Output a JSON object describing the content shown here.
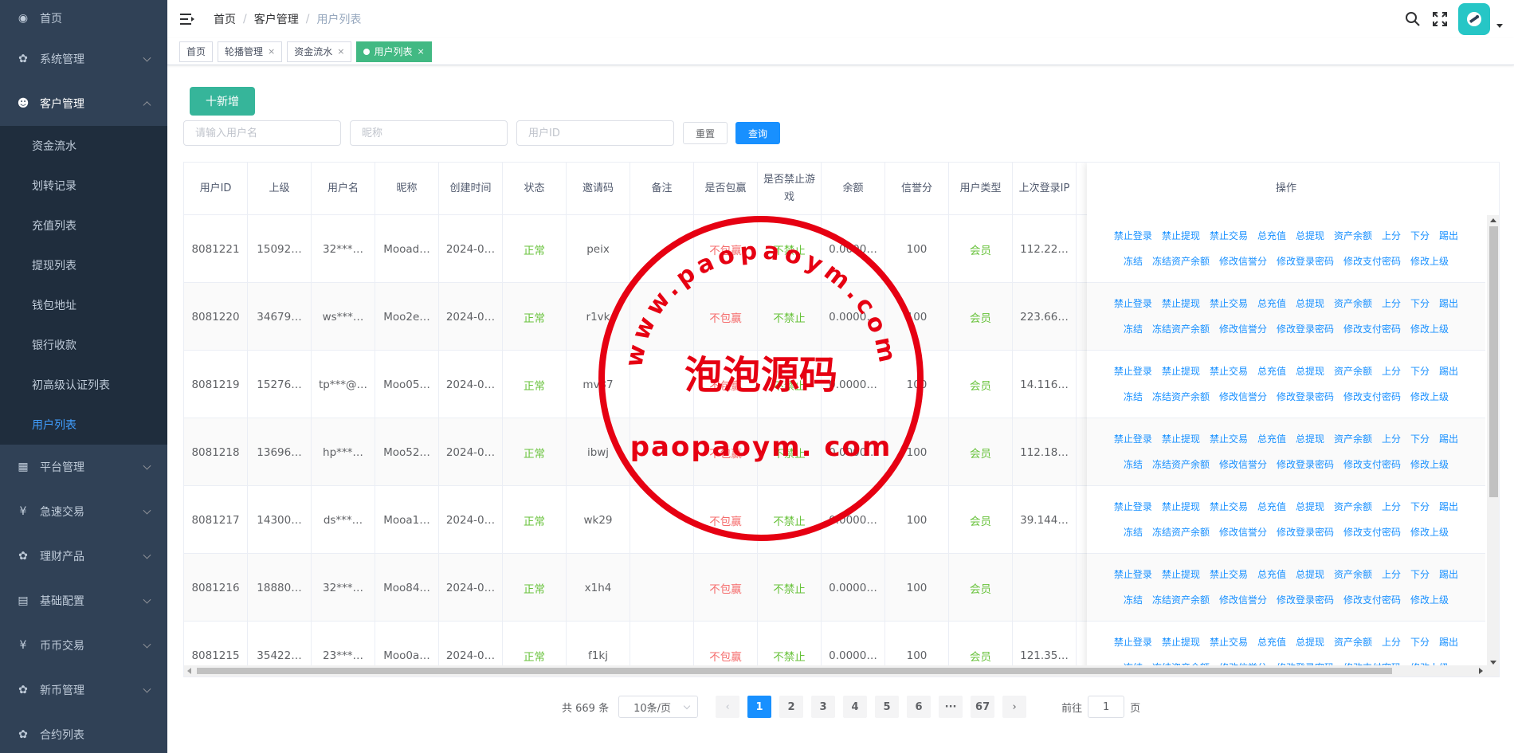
{
  "sidebar": {
    "items": [
      {
        "label": "首页",
        "icon": "dashboard-icon",
        "arrow": false
      },
      {
        "label": "系统管理",
        "icon": "gear-icon",
        "arrow": true
      },
      {
        "label": "客户管理",
        "icon": "user-icon",
        "arrow": true,
        "open": true
      },
      {
        "label": "平台管理",
        "icon": "grid-icon",
        "arrow": true
      },
      {
        "label": "急速交易",
        "icon": "yen-icon",
        "arrow": true
      },
      {
        "label": "理财产品",
        "icon": "gear-icon",
        "arrow": true
      },
      {
        "label": "基础配置",
        "icon": "book-icon",
        "arrow": true
      },
      {
        "label": "币币交易",
        "icon": "yen-icon",
        "arrow": true
      },
      {
        "label": "新币管理",
        "icon": "gear-icon",
        "arrow": true
      },
      {
        "label": "合约列表",
        "icon": "gear-icon",
        "arrow": false
      }
    ],
    "sub_items": [
      "资金流水",
      "划转记录",
      "充值列表",
      "提现列表",
      "钱包地址",
      "银行收款",
      "初高级认证列表",
      "用户列表"
    ]
  },
  "breadcrumb": [
    "首页",
    "客户管理",
    "用户列表"
  ],
  "tags": [
    {
      "label": "首页",
      "closable": false
    },
    {
      "label": "轮播管理",
      "closable": true
    },
    {
      "label": "资金流水",
      "closable": true
    },
    {
      "label": "用户列表",
      "closable": true,
      "active": true
    }
  ],
  "toolbar": {
    "add_label": "十新增",
    "reset_label": "重置",
    "query_label": "查询"
  },
  "filters": {
    "username_placeholder": "请输入用户名",
    "nickname_placeholder": "昵称",
    "userid_placeholder": "用户ID"
  },
  "table": {
    "columns": [
      "用户ID",
      "上级",
      "用户名",
      "昵称",
      "创建时间",
      "状态",
      "邀请码",
      "备注",
      "是否包赢",
      "是否禁止游戏",
      "余额",
      "信誉分",
      "用户类型",
      "上次登录IP"
    ],
    "ops_header": "操作",
    "rows": [
      [
        "8081221",
        "15092…",
        "32***…",
        "Mooad…",
        "2024-0…",
        "正常",
        "peix",
        "",
        "不包赢",
        "不禁止",
        "0.0000…",
        "100",
        "会员",
        "112.22…"
      ],
      [
        "8081220",
        "34679…",
        "ws***…",
        "Moo2e…",
        "2024-0…",
        "正常",
        "r1vk",
        "",
        "不包赢",
        "不禁止",
        "0.0000…",
        "100",
        "会员",
        "223.66…"
      ],
      [
        "8081219",
        "15276…",
        "tp***@…",
        "Moo05…",
        "2024-0…",
        "正常",
        "mv37",
        "",
        "不包赢",
        "不禁止",
        "0.0000…",
        "100",
        "会员",
        "14.116…"
      ],
      [
        "8081218",
        "13696…",
        "hp***…",
        "Moo52…",
        "2024-0…",
        "正常",
        "ibwj",
        "",
        "不包赢",
        "不禁止",
        "0.0000…",
        "100",
        "会员",
        "112.18…"
      ],
      [
        "8081217",
        "14300…",
        "ds***…",
        "Mooa1…",
        "2024-0…",
        "正常",
        "wk29",
        "",
        "不包赢",
        "不禁止",
        "0.0000…",
        "100",
        "会员",
        "39.144…"
      ],
      [
        "8081216",
        "18880…",
        "32***…",
        "Moo84…",
        "2024-0…",
        "正常",
        "x1h4",
        "",
        "不包赢",
        "不禁止",
        "0.0000…",
        "100",
        "会员",
        ""
      ],
      [
        "8081215",
        "35422…",
        "23***…",
        "Moo0a…",
        "2024-0…",
        "正常",
        "f1kj",
        "",
        "不包赢",
        "不禁止",
        "0.0000…",
        "100",
        "会员",
        "121.35…"
      ]
    ],
    "ops_line1": [
      "禁止登录",
      "禁止提现",
      "禁止交易",
      "总充值",
      "总提现",
      "资产余额",
      "上分",
      "下分",
      "踢出"
    ],
    "ops_line2": [
      "冻结",
      "冻结资产余额",
      "修改信誉分",
      "修改登录密码",
      "修改支付密码",
      "修改上级"
    ]
  },
  "pagination": {
    "total": "共 669 条",
    "page_size": "10条/页",
    "pages": [
      "1",
      "2",
      "3",
      "4",
      "5",
      "6",
      "···",
      "67"
    ],
    "goto_label": "前往",
    "goto_value": "1",
    "page_unit": "页"
  },
  "watermark": {
    "arc_text": "www.paopaoym.com",
    "center_text": "泡泡源码",
    "bottom_text": "paopaoym. com",
    "color": "#e60012"
  },
  "colors": {
    "sidebar_bg": "#304156",
    "active_blue": "#409eff",
    "tag_green": "#42b983",
    "add_green": "#36b59a",
    "link_blue": "#1890ff",
    "status_green": "#67c23a",
    "status_red": "#f56c6c"
  }
}
